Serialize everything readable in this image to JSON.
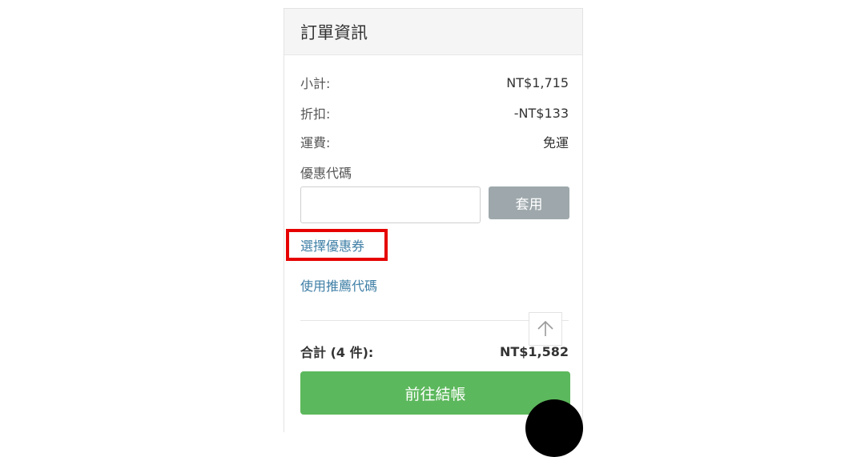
{
  "order": {
    "title": "訂單資訊",
    "subtotal_label": "小計:",
    "subtotal_value": "NT$1,715",
    "discount_label": "折扣:",
    "discount_value": "-NT$133",
    "shipping_label": "運費:",
    "shipping_value": "免運",
    "coupon_label": "優惠代碼",
    "coupon_value": "",
    "apply_label": "套用",
    "select_coupon_link": "選擇優惠券",
    "referral_link": "使用推薦代碼",
    "total_label": "合計 (4 件):",
    "total_value": "NT$1,582",
    "checkout_label": "前往結帳"
  },
  "colors": {
    "checkout": "#5cb85c",
    "apply": "#9ea8ac",
    "link": "#3f7fa6",
    "highlight": "#e60000"
  }
}
